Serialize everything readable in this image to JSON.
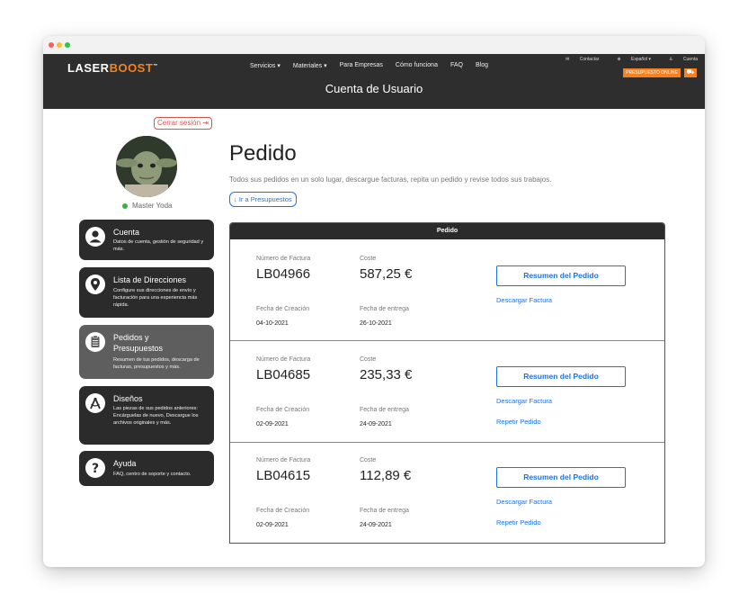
{
  "brand": {
    "logo_laser": "LASER",
    "logo_boost": "BOOST",
    "logo_tm": "™"
  },
  "nav": [
    "Servicios",
    "Materiales",
    "Para Empresas",
    "Cómo funciona",
    "FAQ",
    "Blog"
  ],
  "utility": {
    "contact": "Contactar",
    "language": "Español",
    "account": "Cuenta"
  },
  "cta": "PRESUPUESTO ONLINE",
  "header_title": "Cuenta de Usuario",
  "sidebar": {
    "logout": "Cerrar sesión",
    "username": "Master Yoda",
    "items": [
      {
        "title": "Cuenta",
        "desc": "Datos de cuenta, gestión de seguridad y más.",
        "icon": "user-icon"
      },
      {
        "title": "Lista de Direcciones",
        "desc": "Configure sus direcciones de envío y facturación para una experiencia más rápida.",
        "icon": "location-pin-icon"
      },
      {
        "title": "Pedidos y Presupuestos",
        "desc": "Resumen de tus pedidos, descarga de facturas, presupuestos y más.",
        "icon": "clipboard-icon"
      },
      {
        "title": "Diseños",
        "desc": "Las piezas de sus pedidos anteriores: Encárguelas de nuevo, Descargue los archivos originales y más.",
        "icon": "compass-icon"
      },
      {
        "title": "Ayuda",
        "desc": "FAQ, centro de soporte y contacto.",
        "icon": "help-icon"
      }
    ]
  },
  "main": {
    "title": "Pedido",
    "subtitle": "Todos sus pedidos en un solo lugar, descargue facturas, repita un pedido y revise todos sus trabajos.",
    "presupuestos_link": "Ir a Presupuestos",
    "table_header": "Pedido",
    "labels": {
      "invoice": "Número de Factura",
      "cost": "Coste",
      "created": "Fecha de Creación",
      "delivery": "Fecha de entrega",
      "summary_button": "Resumen del Pedido",
      "download": "Descargar Factura",
      "repeat": "Repetir Pedido"
    },
    "orders": [
      {
        "invoice": "LB04966",
        "cost": "587,25 €",
        "created": "04-10-2021",
        "delivery": "26-10-2021",
        "repeatable": false
      },
      {
        "invoice": "LB04685",
        "cost": "235,33 €",
        "created": "02-09-2021",
        "delivery": "24-09-2021",
        "repeatable": true
      },
      {
        "invoice": "LB04615",
        "cost": "112,89 €",
        "created": "02-09-2021",
        "delivery": "24-09-2021",
        "repeatable": true
      }
    ]
  },
  "colors": {
    "accent": "#f5821f",
    "link": "#1a73e8",
    "dark": "#2b2b2b",
    "logout": "#d9534f",
    "online": "#3cb043"
  }
}
